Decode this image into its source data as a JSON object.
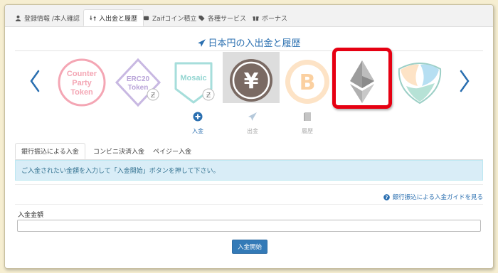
{
  "nav": {
    "tabs": [
      {
        "label": "登録情報 /本人確認",
        "icon": "user-icon"
      },
      {
        "label": "入出金と履歴",
        "icon": "exchange-icon"
      },
      {
        "label": "Zaifコイン積立",
        "icon": "piggybank-icon"
      },
      {
        "label": "各種サービス",
        "icon": "tag-icon"
      },
      {
        "label": "ボーナス",
        "icon": "gift-icon"
      }
    ],
    "active": "入出金と履歴"
  },
  "page": {
    "title": "日本円の入出金と履歴",
    "title_icon": "send-icon"
  },
  "carousel": {
    "prev_icon": "chevron-left-icon",
    "next_icon": "chevron-right-icon",
    "coins": [
      {
        "name": "counterparty-token",
        "label_lines": [
          "Counter",
          "Party",
          "Token"
        ]
      },
      {
        "name": "erc20-token",
        "label_lines": [
          "ERC20",
          "Token"
        ]
      },
      {
        "name": "mosaic",
        "label_lines": [
          "Mosaic"
        ]
      },
      {
        "name": "jpy",
        "label_lines": [
          "¥"
        ],
        "selected": true
      },
      {
        "name": "bitcoin",
        "label_lines": [
          "B"
        ]
      },
      {
        "name": "ethereum",
        "label_lines": [],
        "highlighted": true
      },
      {
        "name": "nem",
        "label_lines": []
      }
    ]
  },
  "actions": [
    {
      "label": "入金",
      "icon": "plus-circle-icon",
      "active": true
    },
    {
      "label": "出金",
      "icon": "send-icon",
      "active": false
    },
    {
      "label": "履歴",
      "icon": "book-icon",
      "active": false
    }
  ],
  "subtabs": [
    {
      "label": "銀行振込による入金",
      "active": true
    },
    {
      "label": "コンビニ決済入金",
      "active": false
    },
    {
      "label": "ペイジー入金",
      "active": false
    }
  ],
  "info_message": "ご入金されたい金額を入力して「入金開始」ボタンを押して下さい。",
  "guide_link": "銀行振込による入金ガイドを見る",
  "form": {
    "amount_label": "入金金額",
    "amount_value": "",
    "submit_label": "入金開始"
  },
  "colors": {
    "accent": "#2a6fb0",
    "highlight_border": "#e60012",
    "info_bg": "#d9edf7",
    "button": "#337ab7"
  }
}
